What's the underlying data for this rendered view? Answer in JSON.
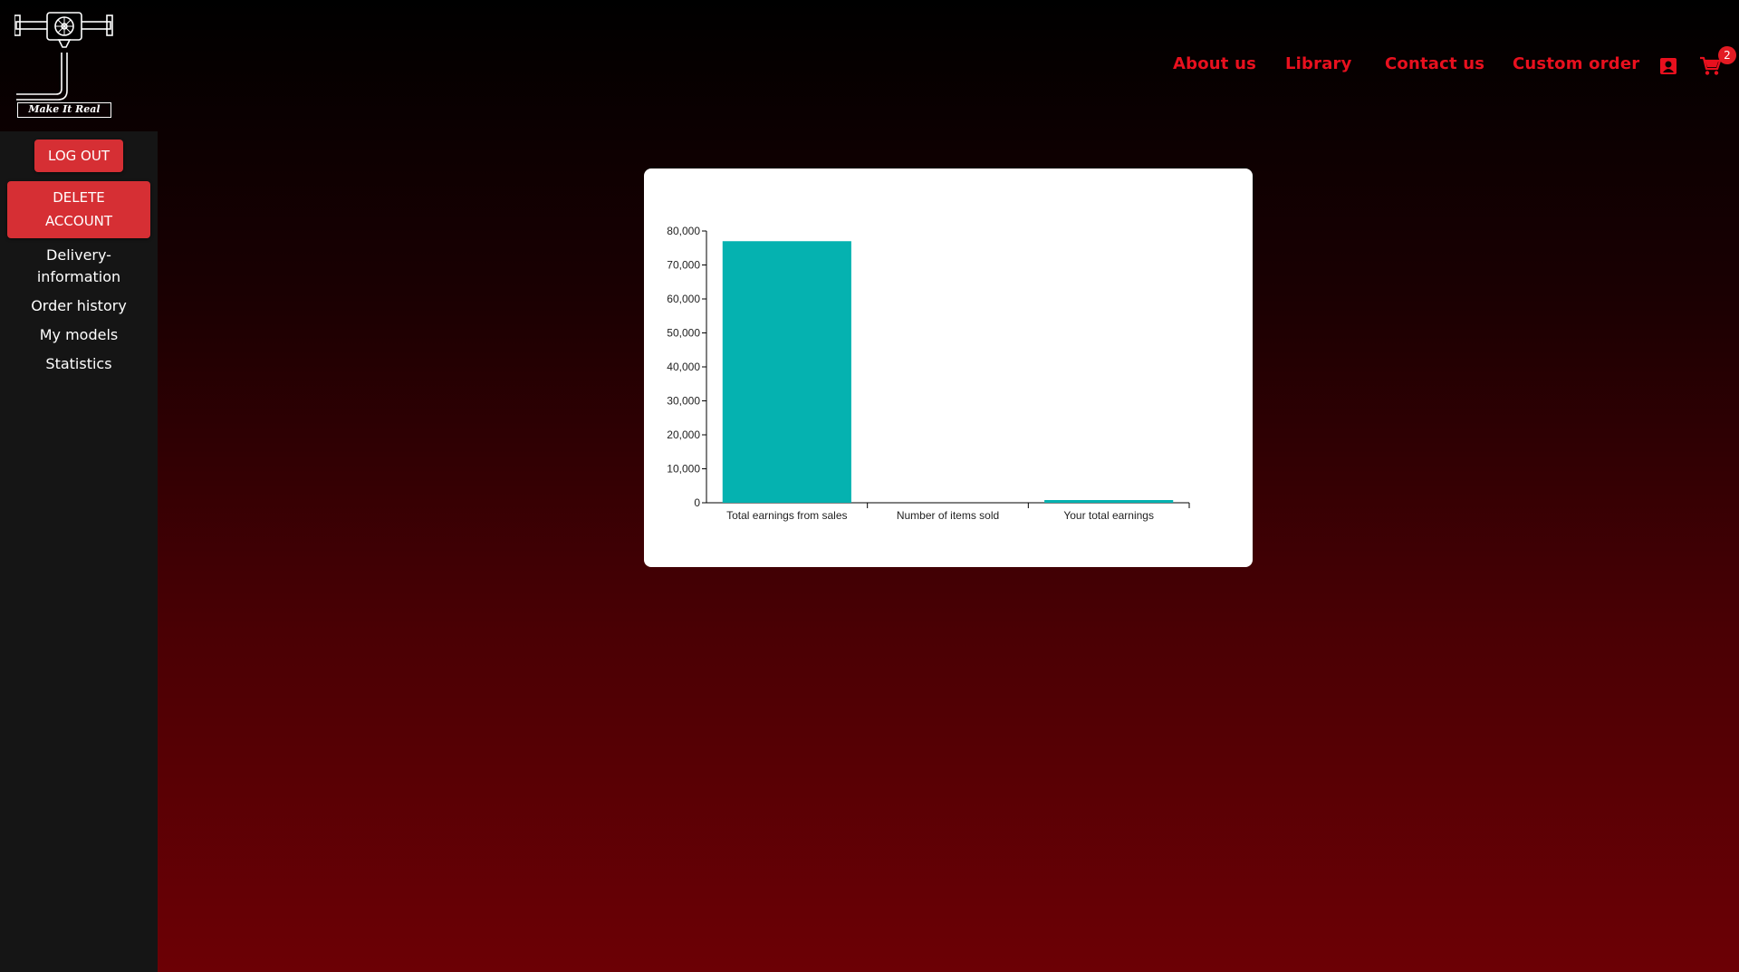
{
  "brand": {
    "logo_text": "Make It Real"
  },
  "nav": {
    "links": [
      "About us",
      "Library",
      "Contact us",
      "Custom order"
    ],
    "user_icon": "account-box-icon",
    "cart_icon": "shopping-cart-icon",
    "cart_count": "2"
  },
  "sidebar": {
    "logout_label": "LOG OUT",
    "delete_label_line1": "DELETE",
    "delete_label_line2": "ACCOUNT",
    "links": [
      "Delivery-",
      "information",
      "Order history",
      "My models",
      "Statistics"
    ]
  },
  "colors": {
    "accent": "#e8101e",
    "button": "#d62f34",
    "bar": "#05b2b0",
    "sidebar_bg": "#151515"
  },
  "chart_data": {
    "type": "bar",
    "categories": [
      "Total earnings from sales",
      "Number of items sold",
      "Your total earnings"
    ],
    "values": [
      77000,
      0,
      800
    ],
    "ylim": [
      0,
      80000
    ],
    "yticks": [
      "0",
      "10,000",
      "20,000",
      "30,000",
      "40,000",
      "50,000",
      "60,000",
      "70,000",
      "80,000"
    ],
    "title": "",
    "xlabel": "",
    "ylabel": "",
    "grid": false
  }
}
